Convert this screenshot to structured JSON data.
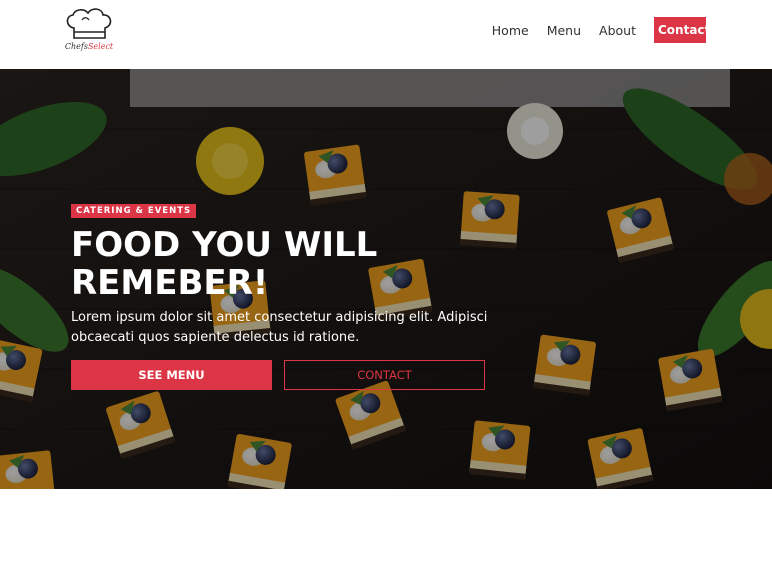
{
  "brand": {
    "logo_name_part1": "Chefs",
    "logo_name_part2": "Select",
    "accent_color": "#dc3545"
  },
  "nav": {
    "items": [
      {
        "label": "Home"
      },
      {
        "label": "Menu"
      },
      {
        "label": "About"
      }
    ],
    "contact_label": "Contact"
  },
  "hero": {
    "badge": "CATERING & EVENTS",
    "title": "FOOD YOU WILL REMEBER!",
    "text": "Lorem ipsum dolor sit amet consectetur adipisicing elit. Adipisci obcaecati quos sapiente delectus id ratione.",
    "primary_button": "SEE MENU",
    "secondary_button": "CONTACT"
  },
  "icons": {
    "logo": "chef-hat-icon"
  }
}
